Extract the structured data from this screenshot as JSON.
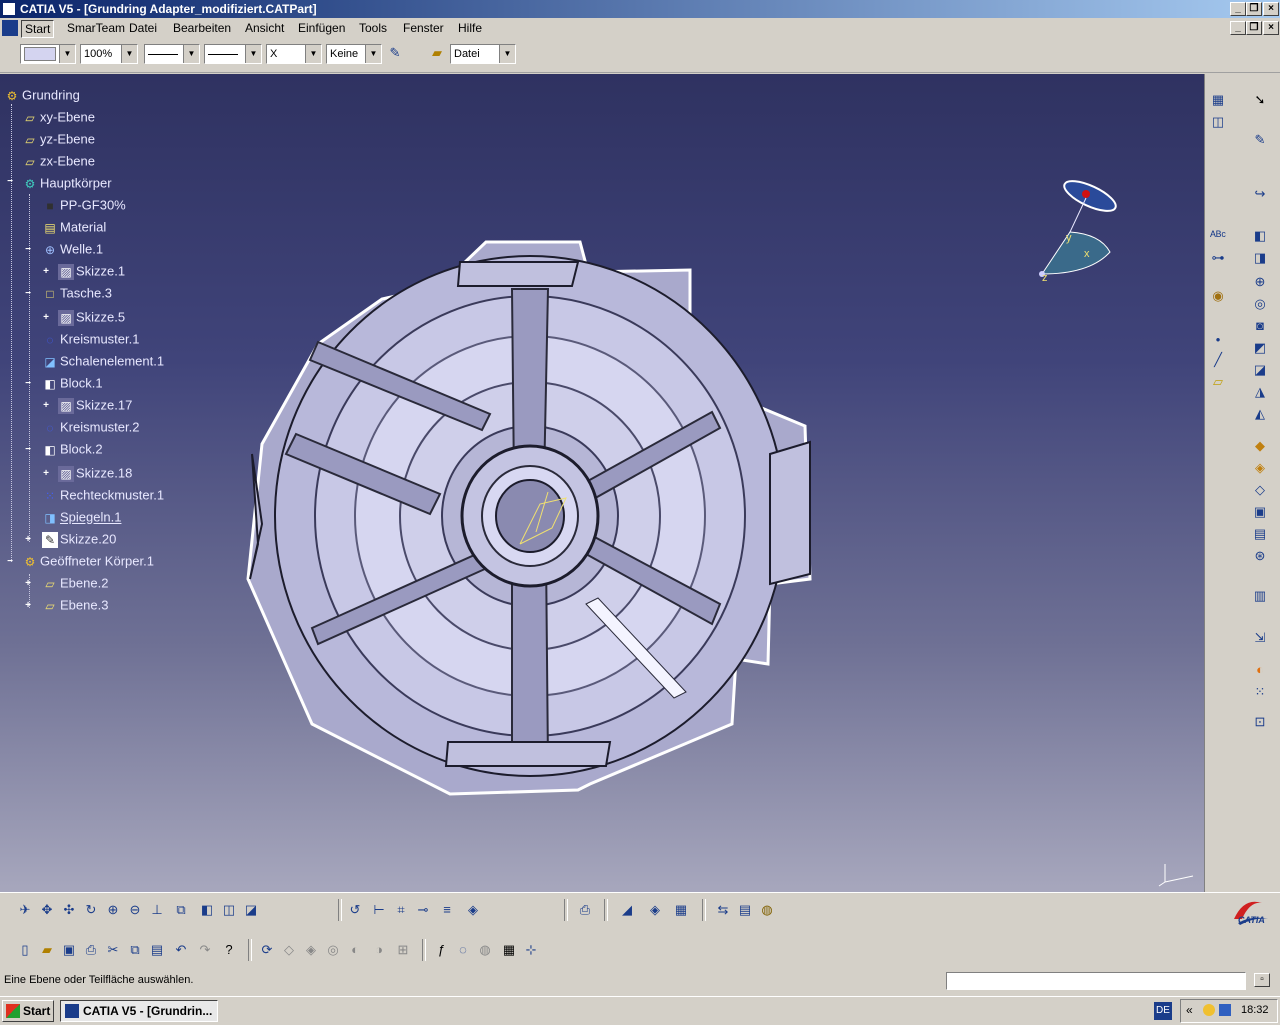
{
  "window": {
    "title": "CATIA V5 - [Grundring Adapter_modifiziert.CATPart]"
  },
  "menubar": {
    "items": [
      "Start",
      "SmarTeam",
      "Datei",
      "Bearbeiten",
      "Ansicht",
      "Einfügen",
      "Tools",
      "Fenster",
      "Hilfe"
    ]
  },
  "toolbar": {
    "zoom": "100%",
    "pick_value": "X",
    "layer": "Keine",
    "file_combo": "Datei"
  },
  "tree": {
    "items": [
      "Grundring",
      "xy-Ebene",
      "yz-Ebene",
      "zx-Ebene",
      "Hauptkörper",
      "PP-GF30%",
      "Material",
      "Welle.1",
      "Skizze.1",
      "Tasche.3",
      "Skizze.5",
      "Kreismuster.1",
      "Schalenelement.1",
      "Block.1",
      "Skizze.17",
      "Kreismuster.2",
      "Block.2",
      "Skizze.18",
      "Rechteckmuster.1",
      "Spiegeln.1",
      "Skizze.20",
      "Geöffneter Körper.1",
      "Ebene.2",
      "Ebene.3"
    ]
  },
  "compass": {
    "x": "x",
    "y": "y",
    "z": "z"
  },
  "logo": {
    "text": "CATIA"
  },
  "status": {
    "message": "Eine Ebene oder Teilfläche auswählen."
  },
  "taskbar": {
    "start": "Start",
    "task": "CATIA V5 - [Grundrin...",
    "lang": "DE",
    "chevron": "«",
    "clock": "18:32"
  },
  "colors": {
    "title_start": "#0a246a",
    "title_end": "#a6caf0",
    "viewport_top": "#2f3261",
    "viewport_bottom": "#a7a7bd",
    "part": "#b8b8d8"
  }
}
